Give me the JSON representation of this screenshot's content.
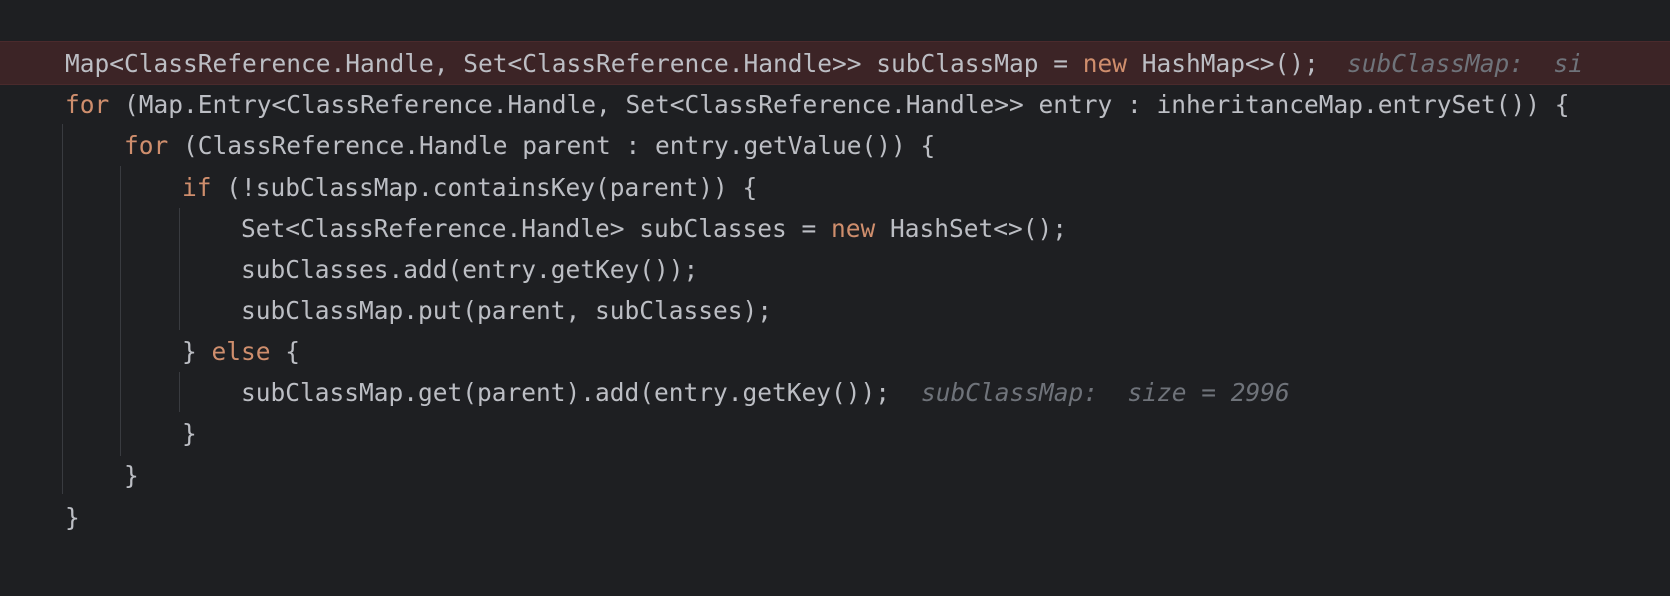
{
  "editor": {
    "colors": {
      "background": "#1e1f22",
      "text": "#bcbec4",
      "keyword": "#cf8e6d",
      "inlay_hint": "#6f737a",
      "breakpoint_line": "#3c2426",
      "indent_guide": "#393b40"
    },
    "lines": [
      {
        "pre": "Map<ClassReference.Handle, Set<ClassReference.Handle>> subClassMap = ",
        "kw": "new",
        "post": " HashMap<>();",
        "hint": "subClassMap:  si"
      },
      {
        "kw": "for",
        "post": " (Map.Entry<ClassReference.Handle, Set<ClassReference.Handle>> entry : inheritanceMap.entrySet()) {"
      },
      {
        "kw": "for",
        "post": " (ClassReference.Handle parent : entry.getValue()) {"
      },
      {
        "kw": "if",
        "post": " (!subClassMap.containsKey(parent)) {"
      },
      {
        "pre": "Set<ClassReference.Handle> subClasses = ",
        "kw": "new",
        "post": " HashSet<>();"
      },
      {
        "text": "subClasses.add(entry.getKey());"
      },
      {
        "text": "subClassMap.put(parent, subClasses);"
      },
      {
        "pre": "} ",
        "kw": "else",
        "post": " {"
      },
      {
        "text": "subClassMap.get(parent).add(entry.getKey());",
        "hint": "subClassMap:  size = 2996"
      },
      {
        "text": "}"
      },
      {
        "text": "}"
      },
      {
        "text": "}"
      }
    ]
  }
}
